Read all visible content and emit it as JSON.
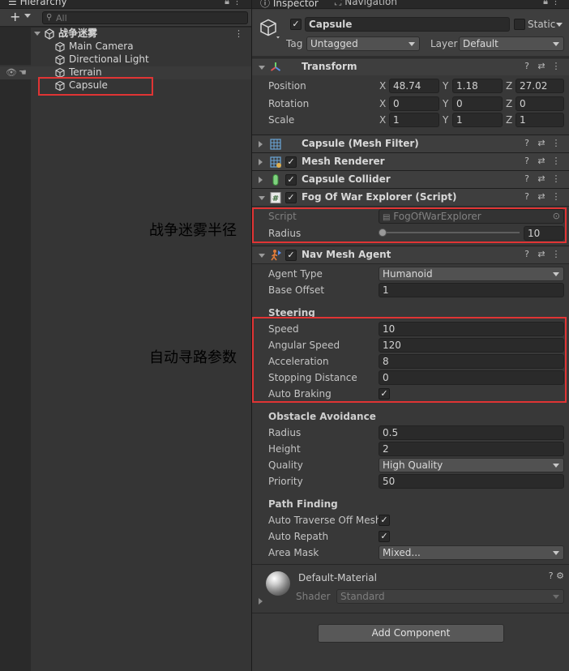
{
  "hierarchy": {
    "tab_label": "Hierarchy",
    "search_placeholder": "All",
    "scene_name": "战争迷雾",
    "items": [
      {
        "label": "Main Camera"
      },
      {
        "label": "Directional Light"
      },
      {
        "label": "Terrain"
      },
      {
        "label": "Capsule"
      }
    ]
  },
  "inspector": {
    "tabs": [
      {
        "label": "Inspector"
      },
      {
        "label": "Navigation"
      }
    ],
    "object": {
      "name": "Capsule",
      "static_label": "Static",
      "tag_label": "Tag",
      "tag_value": "Untagged",
      "layer_label": "Layer",
      "layer_value": "Default"
    },
    "transform": {
      "title": "Transform",
      "position_label": "Position",
      "rotation_label": "Rotation",
      "scale_label": "Scale",
      "axis_labels": [
        "X",
        "Y",
        "Z"
      ],
      "position": [
        "48.74",
        "1.18",
        "27.02"
      ],
      "rotation": [
        "0",
        "0",
        "0"
      ],
      "scale": [
        "1",
        "1",
        "1"
      ]
    },
    "mesh_filter": {
      "title": "Capsule (Mesh Filter)"
    },
    "mesh_renderer": {
      "title": "Mesh Renderer"
    },
    "capsule_collider": {
      "title": "Capsule Collider"
    },
    "fog_explorer": {
      "title": "Fog Of War Explorer (Script)",
      "script_label": "Script",
      "script_value": "FogOfWarExplorer",
      "radius_label": "Radius",
      "radius_value": "10"
    },
    "nav_agent": {
      "title": "Nav Mesh Agent",
      "agent_type_label": "Agent Type",
      "agent_type_value": "Humanoid",
      "base_offset_label": "Base Offset",
      "base_offset_value": "1",
      "steering_header": "Steering",
      "speed_label": "Speed",
      "speed_value": "10",
      "angular_speed_label": "Angular Speed",
      "angular_speed_value": "120",
      "acceleration_label": "Acceleration",
      "acceleration_value": "8",
      "stopping_distance_label": "Stopping Distance",
      "stopping_distance_value": "0",
      "auto_braking_label": "Auto Braking",
      "obstacle_header": "Obstacle Avoidance",
      "radius_label": "Radius",
      "radius_value": "0.5",
      "height_label": "Height",
      "height_value": "2",
      "quality_label": "Quality",
      "quality_value": "High Quality",
      "priority_label": "Priority",
      "priority_value": "50",
      "path_header": "Path Finding",
      "auto_traverse_label": "Auto Traverse Off Mesh",
      "auto_repath_label": "Auto Repath",
      "area_mask_label": "Area Mask",
      "area_mask_value": "Mixed..."
    },
    "material": {
      "name": "Default-Material",
      "shader_label": "Shader",
      "shader_value": "Standard"
    },
    "add_component_label": "Add Component"
  },
  "annotations": {
    "fog_radius": "战争迷雾半径",
    "nav_params": "自动寻路参数"
  },
  "colors": {
    "highlight_border": "#e03434",
    "panel_bg": "#383838"
  },
  "icons": [
    "plus-icon",
    "search-icon",
    "lock-icon",
    "more-icon",
    "scene-icon",
    "gameobject-icon",
    "eye-icon",
    "hand-icon",
    "help-icon",
    "preset-icon",
    "transform-icon",
    "mesh-filter-icon",
    "mesh-renderer-icon",
    "collider-icon",
    "script-icon",
    "nav-agent-icon",
    "material-sphere-icon",
    "gear-icon"
  ]
}
